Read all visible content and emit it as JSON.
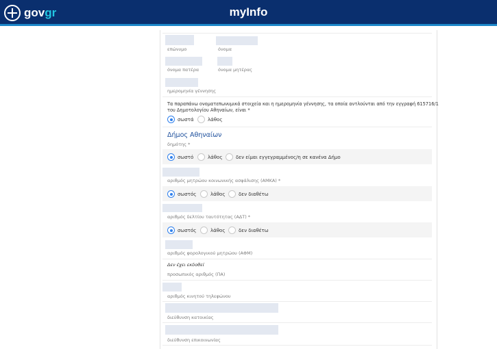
{
  "header": {
    "logo_gov": "gov",
    "logo_gr": "gr",
    "title": "myInfo"
  },
  "form": {
    "labels": {
      "surname": "επώνυμο",
      "name": "όνομα",
      "father_name": "όνομα πατέρα",
      "mother_name": "όνομα μητέρας",
      "birth_date": "ημερομηνία γέννησης",
      "citizen": "δημότης *",
      "amka": "αριθμός μητρώου κοινωνικής ασφάλισης (ΑΜΚΑ) *",
      "adt": "αριθμός δελτίου ταυτότητας (ΑΔΤ) *",
      "afm": "αριθμός φορολογικού μητρώου (ΑΦΜ)",
      "pa": "προσωπικός αριθμός (ΠΑ)",
      "mobile": "αριθμός κινητού τηλεφώνου",
      "address": "διεύθυνση κατοικίας",
      "contact_address": "διεύθυνση επικοινωνίας"
    },
    "registry_statement_line1": "Τα παραπάνω ονοματεπωνυμικά στοιχεία και η ημερομηνία γέννησης, τα οποία αντλούνται από την εγγραφή 615716/1",
    "registry_statement_line2": "του Δημοτολογίου Αθηναίων, είναι *",
    "registry_options": [
      "σωστά",
      "λάθος"
    ],
    "registry_selected": "σωστά",
    "municipality": "Δήμος Αθηναίων",
    "citizen_options": [
      "σωστό",
      "λάθος",
      "δεν είμαι εγγεγραμμένος/η σε κανένα Δήμο"
    ],
    "citizen_selected": "σωστό",
    "amka_options": [
      "σωστός",
      "λάθος",
      "δεν διαθέτω"
    ],
    "amka_selected": "σωστός",
    "adt_options": [
      "σωστός",
      "λάθος",
      "δεν διαθέτω"
    ],
    "adt_selected": "σωστός",
    "pa_value": "Δεν έχει εκδοθεί"
  }
}
